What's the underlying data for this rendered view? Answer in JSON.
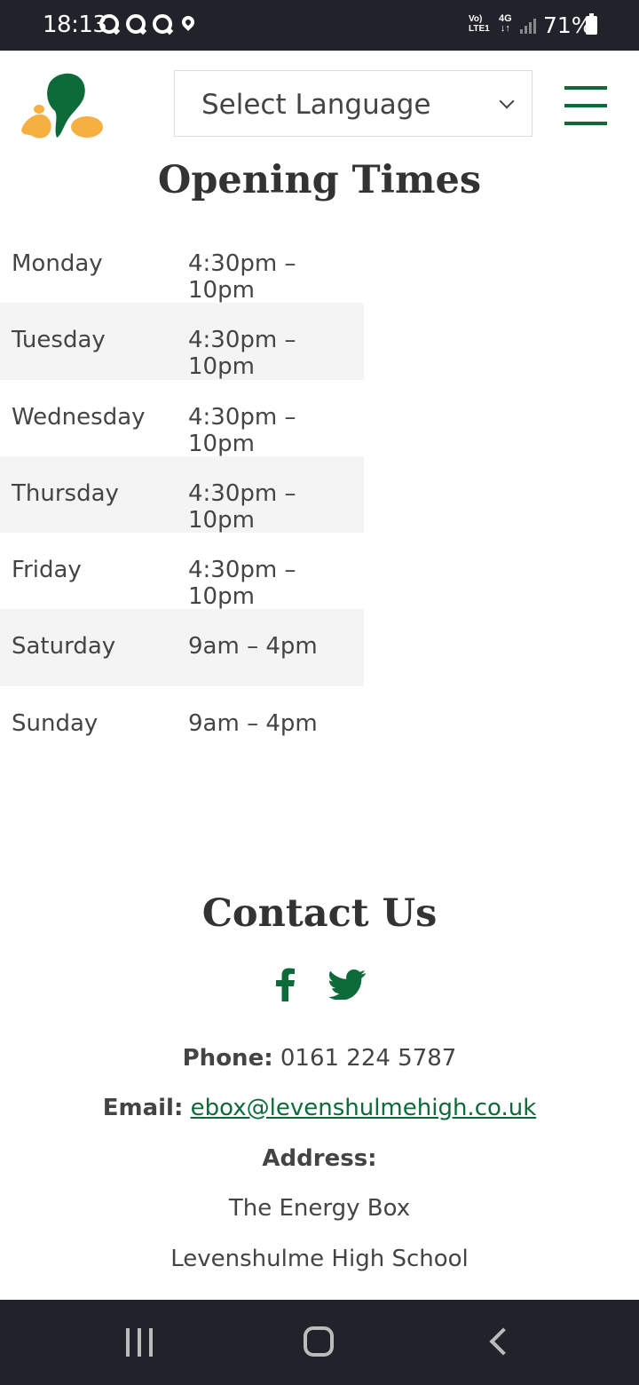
{
  "status_bar": {
    "time": "18:13",
    "network_top": "Vo)",
    "network_bottom": "LTE1",
    "data_type": "4G",
    "battery": "71%"
  },
  "header": {
    "language_select": "Select Language",
    "brand_colors": {
      "green": "#0d6b3a",
      "orange": "#f6b042"
    }
  },
  "opening_times": {
    "title": "Opening Times",
    "rows": [
      {
        "day": "Monday",
        "hours": "4:30pm – 10pm"
      },
      {
        "day": "Tuesday",
        "hours": "4:30pm – 10pm"
      },
      {
        "day": "Wednesday",
        "hours": "4:30pm – 10pm"
      },
      {
        "day": "Thursday",
        "hours": "4:30pm – 10pm"
      },
      {
        "day": "Friday",
        "hours": "4:30pm – 10pm"
      },
      {
        "day": "Saturday",
        "hours": "9am – 4pm"
      },
      {
        "day": "Sunday",
        "hours": "9am – 4pm"
      }
    ]
  },
  "contact": {
    "title": "Contact Us",
    "phone_label": "Phone:",
    "phone": "0161 224 5787",
    "email_label": "Email:",
    "email": "ebox@levenshulmehigh.co.uk",
    "address_label": "Address:",
    "address_line1": "The Energy Box",
    "address_line2": "Levenshulme High School"
  }
}
